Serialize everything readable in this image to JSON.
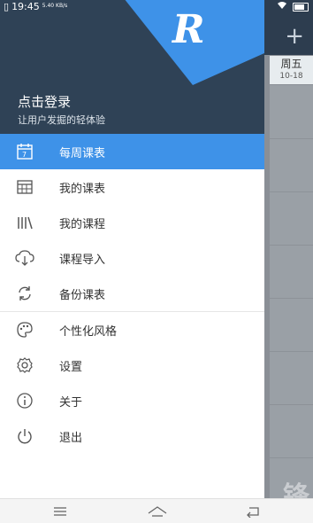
{
  "status": {
    "time": "19:45",
    "speed": "5.40 KB/s"
  },
  "background": {
    "day_name": "周五",
    "day_date": "10-18",
    "watermark": "锋",
    "plus": "+"
  },
  "drawer": {
    "login_title": "点击登录",
    "login_subtitle": "让用户发掘的轻体验",
    "logo_letter": "R",
    "menu": [
      {
        "icon": "calendar-icon",
        "label": "每周课表",
        "active": true
      },
      {
        "icon": "table-icon",
        "label": "我的课表",
        "active": false
      },
      {
        "icon": "books-icon",
        "label": "我的课程",
        "active": false
      },
      {
        "icon": "cloud-download-icon",
        "label": "课程导入",
        "active": false
      },
      {
        "icon": "sync-icon",
        "label": "备份课表",
        "active": false
      },
      {
        "icon": "palette-icon",
        "label": "个性化风格",
        "active": false
      },
      {
        "icon": "gear-icon",
        "label": "设置",
        "active": false
      },
      {
        "icon": "info-icon",
        "label": "关于",
        "active": false
      },
      {
        "icon": "power-icon",
        "label": "退出",
        "active": false
      }
    ]
  },
  "colors": {
    "header": "#2f4256",
    "accent": "#3e92e8",
    "logo": "#3e92e8"
  }
}
